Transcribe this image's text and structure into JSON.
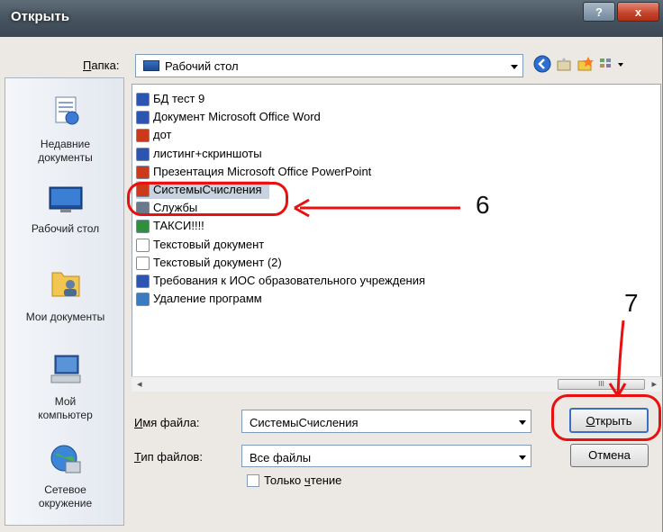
{
  "title": "Открыть",
  "titlebar": {
    "help": "?",
    "close": "x"
  },
  "folder": {
    "label_before": "",
    "label_u": "П",
    "label_after": "апка:",
    "value": "Рабочий стол"
  },
  "places": [
    {
      "name": "Недавние документы",
      "lines": [
        "Недавние",
        "документы"
      ]
    },
    {
      "name": "Рабочий стол",
      "lines": [
        "Рабочий стол"
      ]
    },
    {
      "name": "Мои документы",
      "lines": [
        "Мои документы"
      ]
    },
    {
      "name": "Мой компьютер",
      "lines": [
        "Мой",
        "компьютер"
      ]
    },
    {
      "name": "Сетевое окружение",
      "lines": [
        "Сетевое",
        "окружение"
      ]
    }
  ],
  "files": [
    {
      "name": "БД тест 9",
      "icon": "word-doc-icon",
      "color": "#2b55b0"
    },
    {
      "name": "Документ Microsoft Office Word",
      "icon": "word-doc-icon",
      "color": "#2b55b0"
    },
    {
      "name": "дот",
      "icon": "powerpoint-icon",
      "color": "#cc3a1c"
    },
    {
      "name": "листинг+скриншоты",
      "icon": "word-doc-icon",
      "color": "#2b55b0"
    },
    {
      "name": "Презентация Microsoft Office PowerPoint",
      "icon": "powerpoint-icon",
      "color": "#cc3a1c"
    },
    {
      "name": "СистемыСчисления",
      "icon": "powerpoint-icon",
      "color": "#cc3a1c",
      "selected": true
    },
    {
      "name": "Службы",
      "icon": "shortcut-icon",
      "color": "#6a7a8a"
    },
    {
      "name": "ТАКСИ!!!!",
      "icon": "image-icon",
      "color": "#2f8f3a"
    },
    {
      "name": "Текстовый документ",
      "icon": "text-file-icon",
      "color": "#ffffff"
    },
    {
      "name": "Текстовый документ (2)",
      "icon": "text-file-icon",
      "color": "#ffffff"
    },
    {
      "name": "Требования к ИОС образовательного учреждения",
      "icon": "word-doc-icon",
      "color": "#2b55b0"
    },
    {
      "name": "Удаление программ",
      "icon": "program-shortcut-icon",
      "color": "#3b7bbf"
    }
  ],
  "filename": {
    "label_u": "И",
    "label_rest": "мя файла:",
    "value": "СистемыСчисления"
  },
  "filetype": {
    "label_u": "Т",
    "label_rest": "ип файлов:",
    "value": "Все файлы"
  },
  "readonly": {
    "label_before": "Только ",
    "label_u": "ч",
    "label_after": "тение",
    "checked": false
  },
  "buttons": {
    "open_u": "О",
    "open_rest": "ткрыть",
    "cancel": "Отмена"
  },
  "scrollbar": {
    "thumb_grip": "III",
    "left_arrow": "◂",
    "right_arrow": "▸"
  },
  "annotations": {
    "step6": "6",
    "step7": "7"
  },
  "colors": {
    "annotation": "#e81010",
    "selection": "#c8d3df"
  }
}
